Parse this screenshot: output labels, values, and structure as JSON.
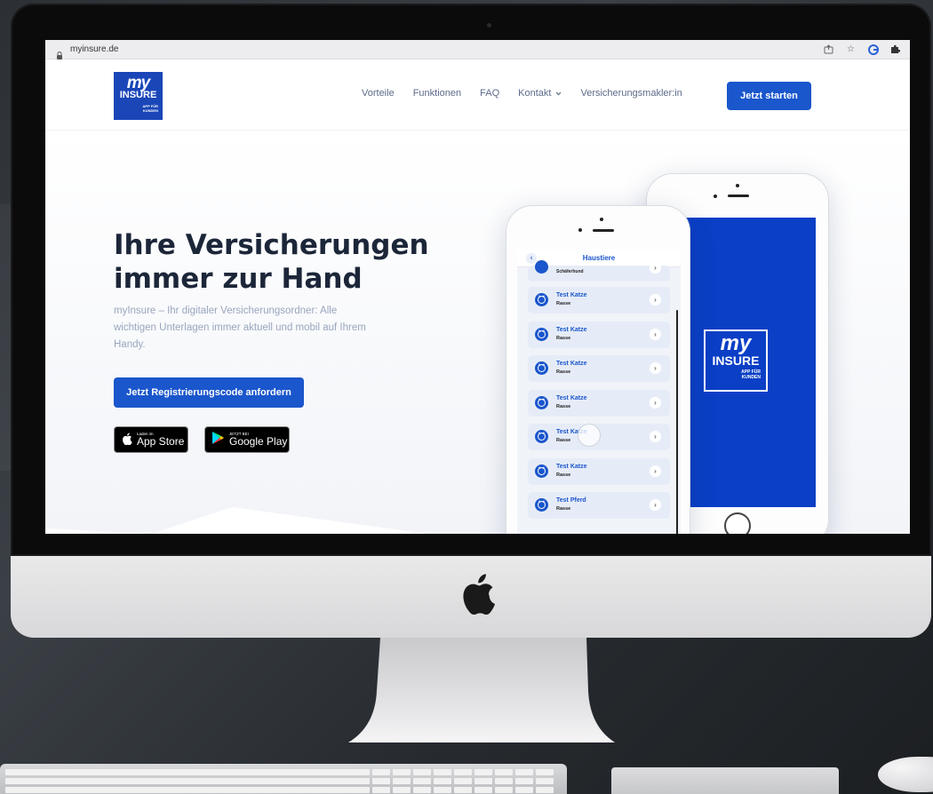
{
  "browser": {
    "url": "myinsure.de",
    "icons": [
      "share-icon",
      "star-icon",
      "extension-g-icon",
      "puzzle-icon"
    ]
  },
  "logo": {
    "line1": "my",
    "line2": "INSURE",
    "tag1": "APP FÜR",
    "tag2": "KUNDEN"
  },
  "nav": {
    "items": [
      {
        "label": "Vorteile"
      },
      {
        "label": "Funktionen"
      },
      {
        "label": "FAQ"
      },
      {
        "label": "Kontakt"
      },
      {
        "label": "Versicherungsmakler:in"
      }
    ],
    "cta_label": "Jetzt starten"
  },
  "hero": {
    "title_line1": "Ihre Versicherungen",
    "title_line2": "immer zur Hand",
    "subtitle": "myInsure – Ihr digitaler Versicherungsordner: Alle wichtigen Unterlagen immer aktuell und mobil auf Ihrem Handy.",
    "cta_label": "Jetzt Registrierungscode anfordern"
  },
  "badges": {
    "appstore_small": "Laden im",
    "appstore_big": "App Store",
    "googleplay_small": "JETZT BEI",
    "googleplay_big": "Google Play"
  },
  "app": {
    "title": "Haustiere",
    "back": "‹",
    "partial_row": "Schäferhund",
    "rows": [
      {
        "name": "Test Katze",
        "sub": "Rasse"
      },
      {
        "name": "Test Katze",
        "sub": "Rasse"
      },
      {
        "name": "Test Katze",
        "sub": "Rasse"
      },
      {
        "name": "Test Katze",
        "sub": "Rasse"
      },
      {
        "name": "Test Katze",
        "sub": "Rasse"
      },
      {
        "name": "Test Katze",
        "sub": "Rasse"
      },
      {
        "name": "Test Pferd",
        "sub": "Rasse"
      }
    ],
    "arrow": "›"
  },
  "colors": {
    "brand_blue": "#1a56cc",
    "logo_blue": "#1a46b8",
    "headline": "#1c2639"
  }
}
